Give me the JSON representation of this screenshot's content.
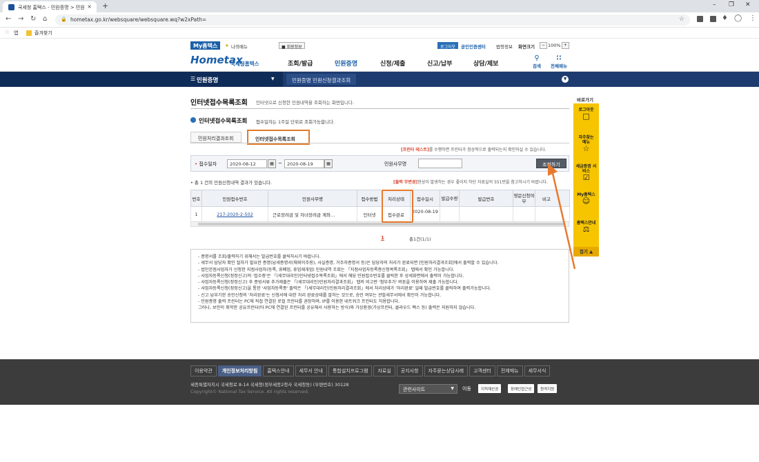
{
  "browser": {
    "tab_title": "국세청 홈택스 - 민원증명 > 민원",
    "tab_close": "×",
    "new_tab": "+",
    "url": "hometax.go.kr/websquare/websquare.wq?w2xPath=",
    "bookmarks": [
      "앱",
      "즐겨찾기"
    ]
  },
  "util_bar": {
    "my_hometax": "My홈택스",
    "my_menu": "나의메뉴",
    "member_info": "회원정보",
    "logout": "로그아웃",
    "cert_center": "공인인증센터",
    "law_info": "법령정보",
    "screen_size": "화면크기",
    "zoom": "100%",
    "zoom_minus": "−",
    "zoom_plus": "+"
  },
  "header": {
    "logo_main": "Hometax",
    "logo_sub": "국세청홈택스",
    "menus": [
      "조회/발급",
      "민원증명",
      "신청/제출",
      "신고/납부",
      "상담/제보"
    ],
    "search": "검색",
    "all_menu": "전체메뉴"
  },
  "lnb": {
    "title": "민원증명",
    "sub": "민원증명 민원신청결과조회"
  },
  "page": {
    "title": "인터넷접수목록조회",
    "title_desc": "인터넷으로 신청한 민원내역을 조회하는 화면입니다.",
    "section_title": "인터넷접수목록조회",
    "section_desc": "접수일자는 1주일 단위로 조회가능합니다.",
    "tabs": [
      "민원처리결과조회",
      "인터넷접수목록조회"
    ],
    "printer_notice_prefix": "[프린터 테스트]",
    "printer_notice_rest": "를 수행하면 프린터가 정상적으로 출력되는지 확인하실 수 있습니다.",
    "search": {
      "date_label": "접수일자",
      "date_from": "2020-08-12",
      "date_to": "2020-08-19",
      "tilde": "~",
      "name_label": "민원사무명",
      "name_value": "",
      "submit": "조회하기"
    },
    "count_text": "총 1 건의 민원신청내역 결과가 있습니다.",
    "output_notice_prefix": "[출력 무변경]",
    "output_notice_rest": "현상이 발생하는 경우 좋이지 하단 자료실의 551번을 참고하시기 바랍니다.",
    "table": {
      "headers": [
        "번호",
        "민원접수번호",
        "민원사무명",
        "접수방법",
        "처리상태",
        "접수일시",
        "발급수량",
        "발급번호",
        "영문신청여부",
        "비고"
      ],
      "rows": [
        [
          "1",
          "217-2020-2-502",
          "근로장려금 및 자녀장려금 계좌…",
          "인터넷",
          "접수완료",
          "2020-08-19",
          "",
          "",
          "",
          ""
        ]
      ]
    },
    "pager_current": "1",
    "pager_total": "총1건(1/1)",
    "notes": [
      "- 증명서를 조회/출력하기 위해서는 발급번호를 클릭하시기 바랍니다.",
      "- 세무서 담당자 확인 절차가 필요한 증명(납세증명서(해외이주용), 사실증명, 거주자증명서 등)은 담당자의 처리가 완료되면 [민원처리결과조회]에서 출력할 수 있습니다.",
      "- 법인본점사업자가 신청한 지점사업자(등록, 휴폐업, 휴업재개업) 민원내역 조회는 「지점사업자등록증신청목록조회」 탭에서 확인 가능합니다.",
      "- 사업자등록신청(정정신고)의 '접수중'은 「(세무대리인)인터넷접수목록조회」에서 해당 민원접수번호를 클릭한 후 상세화면에서 출력이 가능합니다.",
      "- 사업자등록신청(정정신고) 후 증빙서류 추가제출은 「(세무대리인)민원처리결과조회」 탭의 비고란 '첨부추가' 버튼을 이용하여 제출 가능합니다.",
      "- 사업자등록신청(정정신고)을 통한 '사업자등록증' 출력은 「(세무대리인)민원처리결과조회」에서 처리상태가 '처리완료' 일때 발급번호를 클릭하여 출력가능합니다.",
      "- 신고 납부기한 승인신청의 '처리완료'는 신청서에 대한 처리 완료상태를 말하는 것으로, 승인 여부는 관할세무서에서 확인이 가능합니다.",
      "- 민원증명 출력 프린터는 PC에 직접 연결된 로컬 프린터를 권장하며, IP를 이용한 네트워크 프린터도 허용합니다.",
      "   그러나, 보안이 취약한 공유프린터(타 PC에 연결된 프린터를 공유해서 사용하는 방식)와 가상환경(가상프린터, 클라우드 팩스 등) 출력은 지원하지 않습니다."
    ]
  },
  "quick": {
    "title": "바로가기",
    "items": [
      "로그아웃",
      "자주찾는 메뉴",
      "세금증명 서비스",
      "My홈택스",
      "홈택스안내"
    ],
    "close": "접기"
  },
  "footer": {
    "links": [
      "이용약관",
      "개인정보처리방침",
      "홈택스안내",
      "세무서 안내",
      "통합설치프로그램",
      "자료실",
      "공지사항",
      "자주묻는상담사례",
      "고객센터",
      "전체메뉴",
      "세무서식"
    ],
    "address": "세종특별자치시 국세청로 8-14 국세청(정부세종2청사 국세청동) (우편번호) 30128",
    "copyright": "Copyright© National Tax Service. All rights reserved.",
    "related_select": "관련사이트",
    "go": "이동",
    "badges": [
      "지적재산권",
      "장애인접근성",
      "원격지원"
    ]
  },
  "colors": {
    "brand_blue": "#1b5fa8",
    "highlight_orange": "#e8792b",
    "quick_yellow": "#f6c500",
    "lnb_navy": "#1d3b6e"
  }
}
